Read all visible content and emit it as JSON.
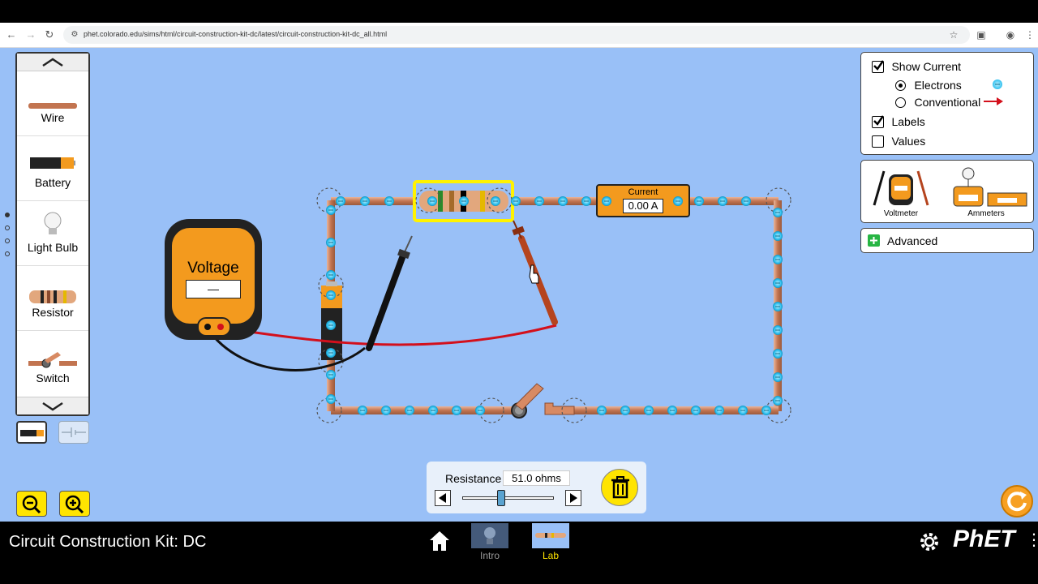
{
  "browser": {
    "url": "phet.colorado.edu/sims/html/circuit-construction-kit-dc/latest/circuit-construction-kit-dc_all.html"
  },
  "toolbox": {
    "items": [
      {
        "label": "Wire"
      },
      {
        "label": "Battery"
      },
      {
        "label": "Light Bulb"
      },
      {
        "label": "Resistor"
      },
      {
        "label": "Switch"
      }
    ]
  },
  "display_panel": {
    "show_current": "Show Current",
    "electrons": "Electrons",
    "conventional": "Conventional",
    "labels": "Labels",
    "values": "Values",
    "show_current_checked": true,
    "electrons_selected": true,
    "labels_checked": true,
    "values_checked": false
  },
  "sensors": {
    "voltmeter": "Voltmeter",
    "ammeters": "Ammeters"
  },
  "advanced": {
    "label": "Advanced"
  },
  "voltmeter": {
    "title": "Voltage",
    "reading": "—"
  },
  "ammeter": {
    "title": "Current",
    "reading": "0.00 A"
  },
  "resistance_control": {
    "label": "Resistance",
    "value": "51.0 ohms",
    "slider_fraction": 0.42
  },
  "app": {
    "title": "Circuit Construction Kit: DC"
  },
  "screens": [
    {
      "label": "Intro"
    },
    {
      "label": "Lab"
    }
  ],
  "brand": {
    "logo": "PhET"
  },
  "colors": {
    "background": "#99c0f7",
    "wire": "#c98563",
    "electron": "#2ec0ef",
    "highlight": "#fff200",
    "meter": "#f39a1e"
  }
}
